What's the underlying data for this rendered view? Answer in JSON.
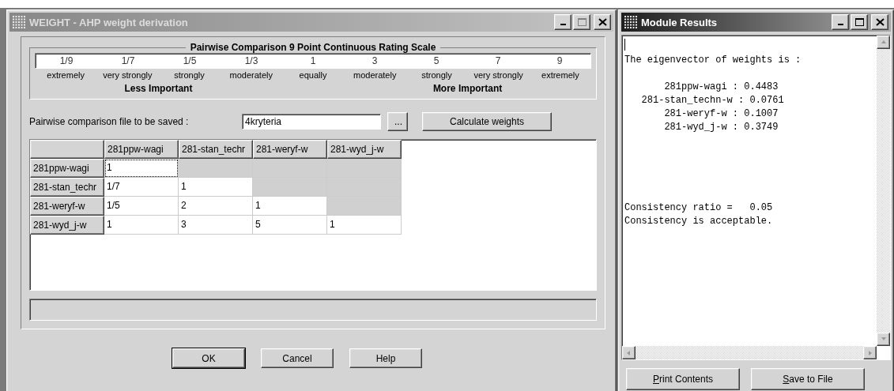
{
  "weight_window": {
    "title": "WEIGHT - AHP weight derivation",
    "active": false,
    "scale": {
      "title": "Pairwise Comparison 9 Point Continuous Rating Scale",
      "points": [
        {
          "value": "1/9",
          "label": "extremely"
        },
        {
          "value": "1/7",
          "label": "very strongly"
        },
        {
          "value": "1/5",
          "label": "strongly"
        },
        {
          "value": "1/3",
          "label": "moderately"
        },
        {
          "value": "1",
          "label": "equally"
        },
        {
          "value": "3",
          "label": "moderately"
        },
        {
          "value": "5",
          "label": "strongly"
        },
        {
          "value": "7",
          "label": "very strongly"
        },
        {
          "value": "9",
          "label": "extremely"
        }
      ],
      "less_label": "Less Important",
      "more_label": "More Important"
    },
    "file_label": "Pairwise comparison file to be saved :",
    "file_value": "4kryteria",
    "browse_button": "...",
    "calculate_button": "Calculate weights",
    "grid": {
      "columns": [
        "281ppw-wagi",
        "281-stan_techr",
        "281-weryf-w",
        "281-wyd_j-w"
      ],
      "rows": [
        {
          "header": "281ppw-wagi",
          "cells": [
            {
              "text": "1",
              "editable": true,
              "focused": true
            },
            {
              "editable": false,
              "focused": false
            },
            {
              "editable": false,
              "focused": false
            },
            {
              "editable": false,
              "focused": false
            }
          ]
        },
        {
          "header": "281-stan_techr",
          "cells": [
            {
              "text": "1/7",
              "editable": true,
              "focused": false
            },
            {
              "text": "1",
              "editable": true,
              "focused": false
            },
            {
              "editable": false,
              "focused": false
            },
            {
              "editable": false,
              "focused": false
            }
          ]
        },
        {
          "header": "281-weryf-w",
          "cells": [
            {
              "text": "1/5",
              "editable": true,
              "focused": false
            },
            {
              "text": "2",
              "editable": true,
              "focused": false
            },
            {
              "text": "1",
              "editable": true,
              "focused": false
            },
            {
              "editable": false,
              "focused": false
            }
          ]
        },
        {
          "header": "281-wyd_j-w",
          "cells": [
            {
              "text": "1",
              "editable": true,
              "focused": false
            },
            {
              "text": "3",
              "editable": true,
              "focused": false
            },
            {
              "text": "5",
              "editable": true,
              "focused": false
            },
            {
              "text": "1",
              "editable": true,
              "focused": false
            }
          ]
        }
      ]
    },
    "buttons": [
      {
        "label": "OK",
        "default": true
      },
      {
        "label": "Cancel",
        "default": false
      },
      {
        "label": "Help",
        "default": false
      }
    ]
  },
  "results_window": {
    "title": "Module Results",
    "active": true,
    "heading": "The eigenvector of weights is :",
    "weights": [
      "       281ppw-wagi : 0.4483",
      "   281-stan_techn-w : 0.0761",
      "       281-weryf-w : 0.1007",
      "       281-wyd_j-w : 0.3749"
    ],
    "consistency": [
      "Consistency ratio =   0.05",
      "Consistency is acceptable."
    ],
    "buttons": [
      {
        "label": "Print Contents",
        "underline_first": true
      },
      {
        "label": "Save to File",
        "underline_first": true
      }
    ]
  }
}
